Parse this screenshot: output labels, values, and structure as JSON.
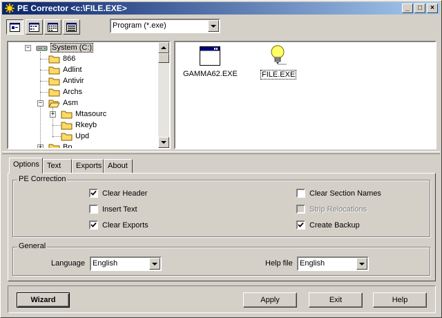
{
  "window": {
    "title": "PE Corrector <c:\\FILE.EXE>",
    "controls": {
      "minimize": "_",
      "maximize": "□",
      "close": "×"
    }
  },
  "toolbar": {
    "buttons": [
      {
        "icon": "large-icons-view-icon",
        "pressed": true
      },
      {
        "icon": "small-icons-view-icon",
        "pressed": false
      },
      {
        "icon": "list-view-icon",
        "pressed": false
      },
      {
        "icon": "details-view-icon",
        "pressed": false
      }
    ],
    "filter": {
      "value": "Program (*.exe)"
    }
  },
  "tree": {
    "root": "System (C:)",
    "items": [
      {
        "label": "866",
        "level": 1
      },
      {
        "label": "Adlint",
        "level": 1
      },
      {
        "label": "Antivir",
        "level": 1
      },
      {
        "label": "Archs",
        "level": 1
      },
      {
        "label": "Asm",
        "level": 1,
        "expanded": true
      },
      {
        "label": "Mtasourc",
        "level": 2,
        "collapsed": true
      },
      {
        "label": "Rkeyb",
        "level": 2
      },
      {
        "label": "Upd",
        "level": 2
      },
      {
        "label": "Bp",
        "level": 1,
        "collapsed": true
      }
    ]
  },
  "files": [
    {
      "name": "GAMMA62.EXE",
      "icon": "application-window-icon",
      "focused": false
    },
    {
      "name": "FILE.EXE",
      "icon": "lightbulb-icon",
      "focused": true
    }
  ],
  "tabs": [
    {
      "label": "Options",
      "active": true
    },
    {
      "label": "Text",
      "active": false
    },
    {
      "label": "Exports",
      "active": false
    },
    {
      "label": "About",
      "active": false
    }
  ],
  "options": {
    "pe_correction": {
      "legend": "PE Correction",
      "checkboxes": [
        {
          "label": "Clear Header",
          "checked": true,
          "disabled": false
        },
        {
          "label": "Insert Text",
          "checked": false,
          "disabled": false
        },
        {
          "label": "Clear Exports",
          "checked": true,
          "disabled": false
        },
        {
          "label": "Clear Section Names",
          "checked": false,
          "disabled": false
        },
        {
          "label": "Strip Relocations",
          "checked": false,
          "disabled": true
        },
        {
          "label": "Create Backup",
          "checked": true,
          "disabled": false
        }
      ]
    },
    "general": {
      "legend": "General",
      "language_label": "Language",
      "language_value": "English",
      "helpfile_label": "Help file",
      "helpfile_value": "English"
    }
  },
  "buttons": {
    "wizard": "Wizard",
    "apply": "Apply",
    "exit": "Exit",
    "help": "Help"
  },
  "colors": {
    "face": "#d4d0c8",
    "title_start": "#0a246a",
    "title_end": "#a6caf0",
    "folder": "#ffd966",
    "bulb": "#ffff66"
  }
}
